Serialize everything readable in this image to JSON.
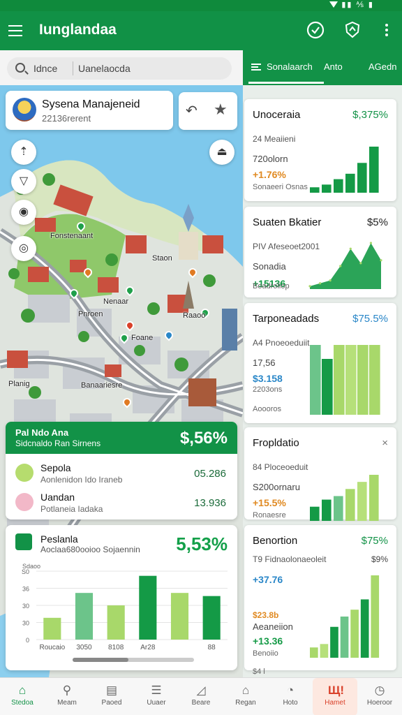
{
  "app": {
    "title": "Iunglandaa"
  },
  "appbar_icons": [
    "check-circle-icon",
    "shield-icon",
    "more-vert-icon"
  ],
  "search": {
    "value_left": "Idnce",
    "value_right": "Uanelaocda"
  },
  "right_tabs": [
    {
      "label": "Sonalaarch",
      "icon": "list-icon"
    },
    {
      "label": "Anto"
    },
    {
      "label": "AGedn"
    }
  ],
  "place": {
    "name": "Sysena Manajeneid",
    "sub": "22136rerent"
  },
  "map_labels": [
    "Fonstenaant",
    "Staon",
    "Nenaar",
    "Pnroen",
    "Foane",
    "Raaoo",
    "Planig",
    "Banaariesre"
  ],
  "stats": {
    "header_line1": "Pal Ndo Ana",
    "header_line2": "Sidcnaldo Ran Sirnens",
    "header_value": "$,56%",
    "rows": [
      {
        "title": "Sepola",
        "sub": "Aonlenidon Ido Iraneb",
        "value": "05.286"
      },
      {
        "title": "Uandan",
        "sub": "Potlaneia Iadaka",
        "value": "13.936"
      }
    ]
  },
  "chart_card": {
    "title": "Peslanla",
    "sub": "Aoclaa680ooioo Sojaennin",
    "value": "5,53%",
    "chart_data": {
      "type": "bar",
      "title": "",
      "categories": [
        "Roucaio",
        "3050",
        "8108",
        "Ar28",
        "",
        "88"
      ],
      "values": [
        14,
        30,
        22,
        41,
        30,
        28
      ],
      "ylim": [
        0,
        44
      ],
      "yticks": [
        "0",
        "30",
        "30",
        "36",
        "S0"
      ],
      "colors": [
        "#a8d86a",
        "#6cc48a",
        "#a8d86a",
        "#149a46",
        "#a8d86a",
        "#149a46"
      ]
    },
    "footer_label": "Sdaoo"
  },
  "right_cards": [
    {
      "title": "Unoceraia",
      "pct": "$,375%",
      "pct_color": "#129247",
      "line1": "24 Meaiieni",
      "line2": "720olorn",
      "line3": "+1.76%",
      "line3_color": "#e08a22",
      "line4": "Sonaeeri Osnas",
      "chart_data": {
        "type": "bar",
        "values": [
          2,
          3,
          5,
          7,
          11,
          17
        ],
        "colors": [
          "#149a46",
          "#149a46",
          "#149a46",
          "#149a46",
          "#149a46",
          "#149a46"
        ]
      }
    },
    {
      "title": "Suaten Bkatier",
      "pct": "$5%",
      "pct_color": "#222",
      "line1": "PIV Afeseoet2001",
      "line2": "Sonadia",
      "line3": "+15136",
      "line3_color": "#149a46",
      "line4": "Boadroliop",
      "chart_data": {
        "type": "area",
        "values": [
          1,
          2,
          3,
          8,
          14,
          9,
          16,
          10
        ],
        "colors": [
          "#a8d86a",
          "#149a46"
        ]
      }
    },
    {
      "title": "Tarponeadads",
      "pct": "$75.5%",
      "pct_color": "#2a87c8",
      "line1": "A4 Pnoeoeduiit",
      "line2": "17,56",
      "line3": "$3.158",
      "line3_color": "#2a87c8",
      "line4": "Aoooros",
      "line5": "2203ons",
      "chart_data": {
        "type": "bar",
        "values": [
          20,
          16,
          20,
          20,
          20,
          20
        ],
        "colors": [
          "#6cc48a",
          "#149a46",
          "#a8d86a",
          "#b6e07a",
          "#a8d86a",
          "#a8d86a"
        ]
      }
    },
    {
      "title": "Fropldatio",
      "pct": "×",
      "pct_color": "#777",
      "line1": "84 Ploceoeduit",
      "line2": "S200ornaru",
      "line3": "+15.5%",
      "line3_color": "#e08a22",
      "line4": "Ronaesre",
      "chart_data": {
        "type": "bar",
        "values": [
          4,
          6,
          7,
          9,
          11,
          13
        ],
        "colors": [
          "#149a46",
          "#149a46",
          "#6cc48a",
          "#a8d86a",
          "#b6e07a",
          "#a8d86a"
        ]
      }
    },
    {
      "title": "Benortion",
      "pct": "$75%",
      "pct_color": "#129247",
      "line1": "T9 Fidnaolonaeoleit",
      "line1b": "$9%",
      "line2": "+37.76",
      "line2_color": "#2a87c8",
      "line3": "$23.8b",
      "line3_color": "#e08a22",
      "line3b": "Aeaneiion",
      "line4": "+13.36",
      "line4_color": "#149a46",
      "line5": "Benoiio",
      "line6": "$4 l",
      "chart_data": {
        "type": "bar",
        "values": [
          3,
          4,
          9,
          12,
          14,
          17,
          24
        ],
        "colors": [
          "#a8d86a",
          "#b6e07a",
          "#149a46",
          "#6cc48a",
          "#a8d86a",
          "#149a46",
          "#a8d86a"
        ]
      }
    }
  ],
  "bottom_nav": [
    {
      "label": "Stedoa",
      "icon": "home-icon",
      "glyph": "⌂",
      "active": true
    },
    {
      "label": "Meam",
      "icon": "search-icon",
      "glyph": "⚲"
    },
    {
      "label": "Paoed",
      "icon": "store-icon",
      "glyph": "▤"
    },
    {
      "label": "Uuaer",
      "icon": "document-icon",
      "glyph": "☰"
    },
    {
      "label": "Beare",
      "icon": "chart-icon",
      "glyph": "◿"
    },
    {
      "label": "Regan",
      "icon": "building-icon",
      "glyph": "⌂"
    },
    {
      "label": "Hoto",
      "icon": "timer-icon",
      "glyph": "◔"
    },
    {
      "label": "Hamet",
      "icon": "alert-icon",
      "glyph": "Щ!",
      "highlight": true
    },
    {
      "label": "Hoeroor",
      "icon": "clock-icon",
      "glyph": "◷"
    }
  ]
}
